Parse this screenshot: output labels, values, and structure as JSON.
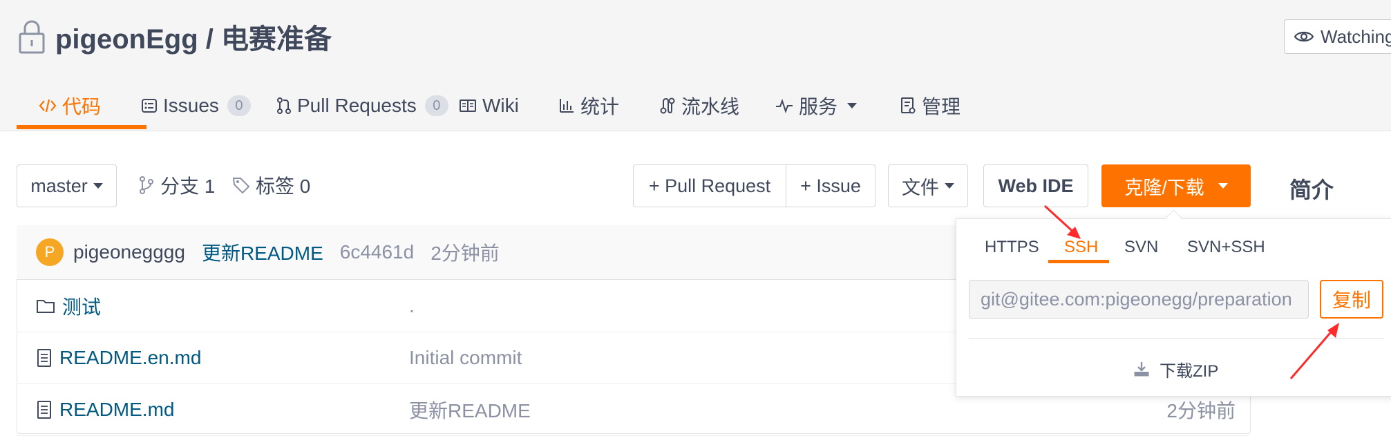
{
  "repo": {
    "title": "pigeonEgg / 电赛准备",
    "watch_label": "Watching"
  },
  "tabs": [
    {
      "label": "代码",
      "active": true
    },
    {
      "label": "Issues",
      "count": "0"
    },
    {
      "label": "Pull Requests",
      "count": "0"
    },
    {
      "label": "Wiki"
    },
    {
      "label": "统计"
    },
    {
      "label": "流水线"
    },
    {
      "label": "服务"
    },
    {
      "label": "管理"
    }
  ],
  "toolbar": {
    "branch": "master",
    "branches_label": "分支 1",
    "tags_label": "标签 0",
    "pull_request_btn": "+ Pull Request",
    "issue_btn": "+ Issue",
    "file_btn": "文件",
    "web_ide_btn": "Web IDE",
    "clone_btn": "克隆/下载",
    "intro_label": "简介"
  },
  "commit": {
    "avatar_letter": "P",
    "user": "pigeonegggg",
    "message": "更新README",
    "hash": "6c4461d",
    "time": "2分钟前"
  },
  "files": [
    {
      "name": "测试",
      "type": "folder",
      "message": ".",
      "time": ""
    },
    {
      "name": "README.en.md",
      "type": "file",
      "message": "Initial commit",
      "time": ""
    },
    {
      "name": "README.md",
      "type": "file",
      "message": "更新README",
      "time": "2分钟前"
    }
  ],
  "clone_dropdown": {
    "protocols": [
      "HTTPS",
      "SSH",
      "SVN",
      "SVN+SSH"
    ],
    "active_protocol": "SSH",
    "url": "git@gitee.com:pigeonegg/preparation",
    "copy_label": "复制",
    "download_zip_label": "下载ZIP"
  },
  "colors": {
    "accent": "#fe7300",
    "link": "#005980",
    "annotation_arrow": "#ff2a2a"
  }
}
